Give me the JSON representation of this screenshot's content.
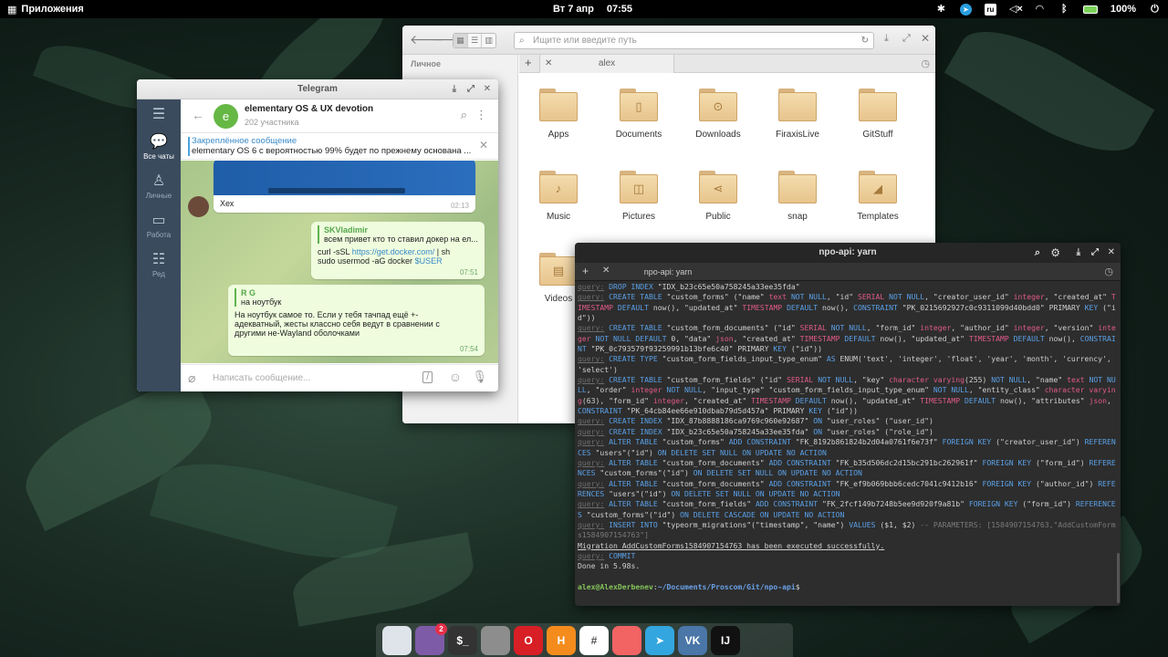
{
  "panel": {
    "apps_label": "Приложения",
    "day": "Вт",
    "date": "7 апр",
    "time": "07:55",
    "battery": "100%",
    "keyboard_layout": "ru"
  },
  "files": {
    "search_placeholder": "Ищите или введите путь",
    "sidebar_title": "Личное",
    "tab_label": "alex",
    "folders": [
      {
        "name": "Apps",
        "glyph": ""
      },
      {
        "name": "Documents",
        "glyph": "▯"
      },
      {
        "name": "Downloads",
        "glyph": "⊙"
      },
      {
        "name": "FiraxisLive",
        "glyph": ""
      },
      {
        "name": "GitStuff",
        "glyph": ""
      },
      {
        "name": "Music",
        "glyph": "♪"
      },
      {
        "name": "Pictures",
        "glyph": "◫"
      },
      {
        "name": "Public",
        "glyph": "⋖"
      },
      {
        "name": "snap",
        "glyph": ""
      },
      {
        "name": "Templates",
        "glyph": "◢"
      },
      {
        "name": "Videos",
        "glyph": "▤"
      }
    ]
  },
  "telegram": {
    "window_title": "Telegram",
    "rail": {
      "all_chats": "Все чаты",
      "personal": "Личные",
      "work": "Работа",
      "edit": "Ред"
    },
    "chat_name": "elementary OS & UX devotion",
    "chat_members": "202 участника",
    "avatar_letter": "e",
    "pinned_title": "Закреплённое сообщение",
    "pinned_text": "elementary OS 6 с вероятностью 99% будет по прежнему основана ...",
    "msg1": {
      "text": "Хех",
      "time": "02:13"
    },
    "msg2": {
      "reply_author": "SKVladimir",
      "reply_text": "всем привет кто то ставил докер на ел...",
      "line1_a": "curl -sSL ",
      "line1_link": "https://get.docker.com/",
      "line1_b": " | sh",
      "line2_a": "sudo usermod -aG docker ",
      "line2_var": "$USER",
      "time": "07:51"
    },
    "msg3": {
      "reply_author": "R G",
      "reply_text": "на ноутбук",
      "text": "На ноутбук самое то. Если у тебя тачпад ещё +- адекватный, жесты классно себя ведут в сравнении с другими не-Wayland оболочками",
      "time": "07:54"
    },
    "composer_placeholder": "Написать сообщение..."
  },
  "terminal": {
    "window_title": "npo-api: yarn",
    "tab_label": "npo-api: yarn",
    "lines": [
      [
        [
          "q",
          "query:"
        ],
        [
          "n",
          " "
        ],
        [
          "k",
          "DROP INDEX"
        ],
        [
          "n",
          " \"IDX_b23c65e50a758245a33ee35fda\""
        ]
      ],
      [
        [
          "q",
          "query:"
        ],
        [
          "n",
          " "
        ],
        [
          "k",
          "CREATE TABLE"
        ],
        [
          "n",
          " \"custom_forms\" (\"name\" "
        ],
        [
          "t",
          "text"
        ],
        [
          "n",
          " "
        ],
        [
          "k",
          "NOT NULL"
        ],
        [
          "n",
          ", \"id\" "
        ],
        [
          "t",
          "SERIAL"
        ],
        [
          "n",
          " "
        ],
        [
          "k",
          "NOT NULL"
        ],
        [
          "n",
          ", \"creator_user_id\" "
        ],
        [
          "t",
          "integer"
        ],
        [
          "n",
          ", \"created_at\" "
        ],
        [
          "t",
          "TIMESTAMP"
        ],
        [
          "n",
          " "
        ],
        [
          "k",
          "DEFAULT"
        ],
        [
          "n",
          " now(), \"updated_at\" "
        ],
        [
          "t",
          "TIMESTAMP"
        ],
        [
          "n",
          " "
        ],
        [
          "k",
          "DEFAULT"
        ],
        [
          "n",
          " now(), "
        ],
        [
          "k",
          "CONSTRAINT"
        ],
        [
          "n",
          " \"PK_0215692927c0c9311099d40bdd0\" PRIMARY "
        ],
        [
          "k",
          "KEY"
        ],
        [
          "n",
          " (\"id\"))"
        ]
      ],
      [
        [
          "q",
          "query:"
        ],
        [
          "n",
          " "
        ],
        [
          "k",
          "CREATE TABLE"
        ],
        [
          "n",
          " \"custom_form_documents\" (\"id\" "
        ],
        [
          "t",
          "SERIAL"
        ],
        [
          "n",
          " "
        ],
        [
          "k",
          "NOT NULL"
        ],
        [
          "n",
          ", \"form_id\" "
        ],
        [
          "t",
          "integer"
        ],
        [
          "n",
          ", \"author_id\" "
        ],
        [
          "t",
          "integer"
        ],
        [
          "n",
          ", \"version\" "
        ],
        [
          "t",
          "integer"
        ],
        [
          "n",
          " "
        ],
        [
          "k",
          "NOT NULL DEFAULT"
        ],
        [
          "n",
          " 0, \"data\" "
        ],
        [
          "t",
          "json"
        ],
        [
          "n",
          ", \"created_at\" "
        ],
        [
          "t",
          "TIMESTAMP"
        ],
        [
          "n",
          " "
        ],
        [
          "k",
          "DEFAULT"
        ],
        [
          "n",
          " now(), \"updated_at\" "
        ],
        [
          "t",
          "TIMESTAMP"
        ],
        [
          "n",
          " "
        ],
        [
          "k",
          "DEFAULT"
        ],
        [
          "n",
          " now(), "
        ],
        [
          "k",
          "CONSTRAINT"
        ],
        [
          "n",
          " \"PK_0c793579f93259991b13bfe6c40\" PRIMARY "
        ],
        [
          "k",
          "KEY"
        ],
        [
          "n",
          " (\"id\"))"
        ]
      ],
      [
        [
          "q",
          "query:"
        ],
        [
          "n",
          " "
        ],
        [
          "k",
          "CREATE TYPE"
        ],
        [
          "n",
          " \"custom_form_fields_input_type_enum\" "
        ],
        [
          "k",
          "AS"
        ],
        [
          "n",
          " ENUM('text', 'integer', 'float', 'year', 'month', 'currency', 'select')"
        ]
      ],
      [
        [
          "q",
          "query:"
        ],
        [
          "n",
          " "
        ],
        [
          "k",
          "CREATE TABLE"
        ],
        [
          "n",
          " \"custom_form_fields\" (\"id\" "
        ],
        [
          "t",
          "SERIAL"
        ],
        [
          "n",
          " "
        ],
        [
          "k",
          "NOT NULL"
        ],
        [
          "n",
          ", \"key\" "
        ],
        [
          "t",
          "character varying"
        ],
        [
          "n",
          "(255) "
        ],
        [
          "k",
          "NOT NULL"
        ],
        [
          "n",
          ", \"name\" "
        ],
        [
          "t",
          "text"
        ],
        [
          "n",
          " "
        ],
        [
          "k",
          "NOT NULL"
        ],
        [
          "n",
          ", \"order\" "
        ],
        [
          "t",
          "integer"
        ],
        [
          "n",
          " "
        ],
        [
          "k",
          "NOT NULL"
        ],
        [
          "n",
          ", \"input_type\" \"custom_form_fields_input_type_enum\" "
        ],
        [
          "k",
          "NOT NULL"
        ],
        [
          "n",
          ", \"entity_class\" "
        ],
        [
          "t",
          "character varying"
        ],
        [
          "n",
          "(63), \"form_id\" "
        ],
        [
          "t",
          "integer"
        ],
        [
          "n",
          ", \"created_at\" "
        ],
        [
          "t",
          "TIMESTAMP"
        ],
        [
          "n",
          " "
        ],
        [
          "k",
          "DEFAULT"
        ],
        [
          "n",
          " now(), \"updated_at\" "
        ],
        [
          "t",
          "TIMESTAMP"
        ],
        [
          "n",
          " "
        ],
        [
          "k",
          "DEFAULT"
        ],
        [
          "n",
          " now(), \"attributes\" "
        ],
        [
          "t",
          "json"
        ],
        [
          "n",
          ", "
        ],
        [
          "k",
          "CONSTRAINT"
        ],
        [
          "n",
          " \"PK_64cb84ee66e910dbab79d5d457a\" PRIMARY "
        ],
        [
          "k",
          "KEY"
        ],
        [
          "n",
          " (\"id\"))"
        ]
      ],
      [
        [
          "q",
          "query:"
        ],
        [
          "n",
          " "
        ],
        [
          "k",
          "CREATE INDEX"
        ],
        [
          "n",
          " \"IDX_87b8888186ca9769c960e92687\" "
        ],
        [
          "k",
          "ON"
        ],
        [
          "n",
          " \"user_roles\" (\"user_id\")"
        ]
      ],
      [
        [
          "q",
          "query:"
        ],
        [
          "n",
          " "
        ],
        [
          "k",
          "CREATE INDEX"
        ],
        [
          "n",
          " \"IDX_b23c65e50a758245a33ee35fda\" "
        ],
        [
          "k",
          "ON"
        ],
        [
          "n",
          " \"user_roles\" (\"role_id\")"
        ]
      ],
      [
        [
          "q",
          "query:"
        ],
        [
          "n",
          " "
        ],
        [
          "k",
          "ALTER TABLE"
        ],
        [
          "n",
          " \"custom_forms\" "
        ],
        [
          "k",
          "ADD CONSTRAINT"
        ],
        [
          "n",
          " \"FK_8192b861824b2d04a0761f6e73f\" "
        ],
        [
          "k",
          "FOREIGN KEY"
        ],
        [
          "n",
          " (\"creator_user_id\") "
        ],
        [
          "k",
          "REFERENCES"
        ],
        [
          "n",
          " \"users\"(\"id\") "
        ],
        [
          "k",
          "ON DELETE SET NULL ON UPDATE NO ACTION"
        ]
      ],
      [
        [
          "q",
          "query:"
        ],
        [
          "n",
          " "
        ],
        [
          "k",
          "ALTER TABLE"
        ],
        [
          "n",
          " \"custom_form_documents\" "
        ],
        [
          "k",
          "ADD CONSTRAINT"
        ],
        [
          "n",
          " \"FK_b35d506dc2d15bc291bc262961f\" "
        ],
        [
          "k",
          "FOREIGN KEY"
        ],
        [
          "n",
          " (\"form_id\") "
        ],
        [
          "k",
          "REFERENCES"
        ],
        [
          "n",
          " \"custom_forms\"(\"id\") "
        ],
        [
          "k",
          "ON DELETE SET NULL ON UPDATE NO ACTION"
        ]
      ],
      [
        [
          "q",
          "query:"
        ],
        [
          "n",
          " "
        ],
        [
          "k",
          "ALTER TABLE"
        ],
        [
          "n",
          " \"custom_form_documents\" "
        ],
        [
          "k",
          "ADD CONSTRAINT"
        ],
        [
          "n",
          " \"FK_ef9b069bbb6cedc7041c9412b16\" "
        ],
        [
          "k",
          "FOREIGN KEY"
        ],
        [
          "n",
          " (\"author_id\") "
        ],
        [
          "k",
          "REFERENCES"
        ],
        [
          "n",
          " \"users\"(\"id\") "
        ],
        [
          "k",
          "ON DELETE SET NULL ON UPDATE NO ACTION"
        ]
      ],
      [
        [
          "q",
          "query:"
        ],
        [
          "n",
          " "
        ],
        [
          "k",
          "ALTER TABLE"
        ],
        [
          "n",
          " \"custom_form_fields\" "
        ],
        [
          "k",
          "ADD CONSTRAINT"
        ],
        [
          "n",
          " \"FK_2fcf149b7248b5ee9d920f9a81b\" "
        ],
        [
          "k",
          "FOREIGN KEY"
        ],
        [
          "n",
          " (\"form_id\") "
        ],
        [
          "k",
          "REFERENCES"
        ],
        [
          "n",
          " \"custom_forms\"(\"id\") "
        ],
        [
          "k",
          "ON DELETE CASCADE ON UPDATE NO ACTION"
        ]
      ],
      [
        [
          "q",
          "query:"
        ],
        [
          "n",
          " "
        ],
        [
          "k",
          "INSERT INTO"
        ],
        [
          "n",
          " \"typeorm_migrations\"(\"timestamp\", \"name\") "
        ],
        [
          "k",
          "VALUES"
        ],
        [
          "n",
          " ($1, $2) "
        ],
        [
          "d",
          "-- PARAMETERS: [1584907154763,\"AddCustomForms1584907154763\"]"
        ]
      ],
      [
        [
          "o",
          "Migration AddCustomForms1584907154763 has been executed successfully."
        ]
      ],
      [
        [
          "q",
          "query:"
        ],
        [
          "n",
          " "
        ],
        [
          "k",
          "COMMIT"
        ]
      ],
      [
        [
          "n",
          "Done in 5.98s."
        ]
      ],
      [
        [
          "n",
          " "
        ]
      ],
      [
        [
          "p",
          "alex@AlexDerbenev"
        ],
        [
          "n",
          ":"
        ],
        [
          "h",
          "~/Documents/Proscom/Git/npo-api"
        ],
        [
          "n",
          "$"
        ]
      ]
    ]
  },
  "dock": {
    "apps": [
      {
        "name": "settings",
        "label": "",
        "color": "#dfe4ea"
      },
      {
        "name": "appcenter",
        "label": "",
        "color": "#7d5ba6",
        "badge": "2"
      },
      {
        "name": "terminal",
        "label": "$_",
        "color": "#333333"
      },
      {
        "name": "files",
        "label": "",
        "color": "#8d8d8d"
      },
      {
        "name": "opera",
        "label": "O",
        "color": "#d81f26"
      },
      {
        "name": "hh",
        "label": "H",
        "color": "#f48c1d"
      },
      {
        "name": "slack",
        "label": "#",
        "color": "#ffffff"
      },
      {
        "name": "asana",
        "label": "",
        "color": "#f26464"
      },
      {
        "name": "telegram",
        "label": "➤",
        "color": "#33a6df"
      },
      {
        "name": "vk",
        "label": "VK",
        "color": "#4a76a8"
      },
      {
        "name": "intellij",
        "label": "IJ",
        "color": "#111111"
      }
    ]
  }
}
